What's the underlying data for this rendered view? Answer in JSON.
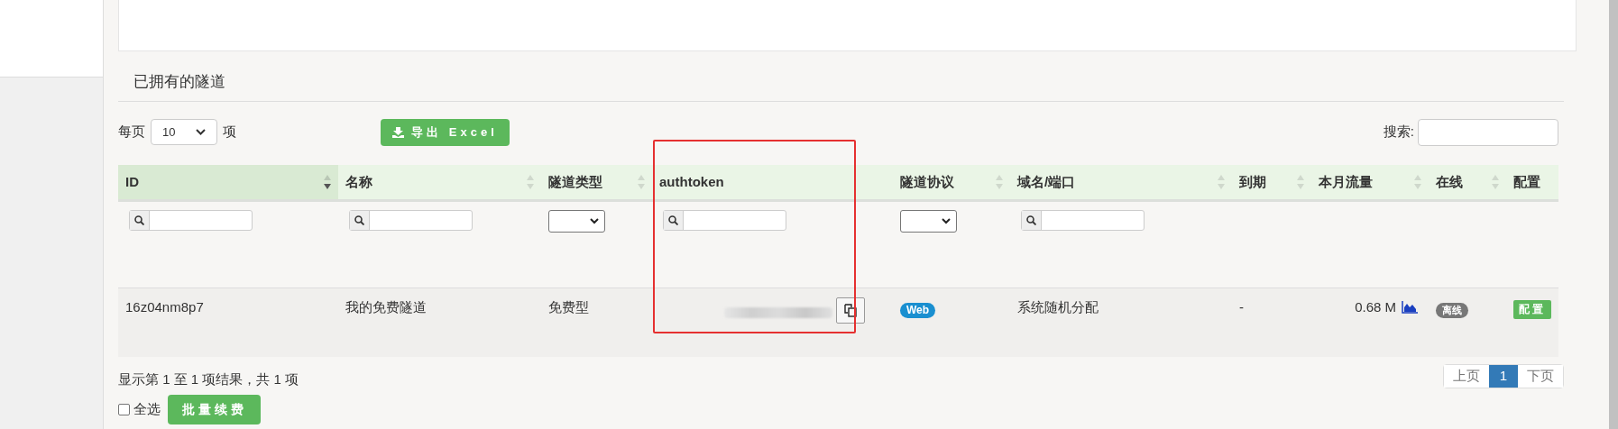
{
  "section_title": "已拥有的隧道",
  "page_size": {
    "label_before": "每页",
    "value": "10",
    "label_after": "项"
  },
  "export_button": "导出 Excel",
  "search": {
    "label": "搜索:"
  },
  "table": {
    "columns": [
      {
        "label": "ID",
        "sortable": true,
        "sorted": true,
        "filter": {
          "kind": "text"
        }
      },
      {
        "label": "名称",
        "sortable": true,
        "sorted": false,
        "filter": {
          "kind": "text"
        }
      },
      {
        "label": "隧道类型",
        "sortable": true,
        "sorted": false,
        "filter": {
          "kind": "select"
        }
      },
      {
        "label": "authtoken",
        "sortable": false,
        "filter": {
          "kind": "text"
        }
      },
      {
        "label": "隧道协议",
        "sortable": true,
        "sorted": false,
        "filter": {
          "kind": "select"
        }
      },
      {
        "label": "域名/端口",
        "sortable": true,
        "sorted": false,
        "filter": {
          "kind": "text"
        }
      },
      {
        "label": "到期",
        "sortable": true,
        "sorted": false
      },
      {
        "label": "本月流量",
        "sortable": true,
        "sorted": false
      },
      {
        "label": "在线",
        "sortable": true,
        "sorted": false
      },
      {
        "label": "配置",
        "sortable": false
      }
    ],
    "rows": [
      {
        "id": "16z04nm8p7",
        "name": "我的免费隧道",
        "type": "免费型",
        "protocol": "Web",
        "domain": "系统随机分配",
        "expiry": "-",
        "traffic": "0.68 M",
        "online_label": "离线",
        "online": false,
        "config_button": "配置"
      }
    ]
  },
  "summary": "显示第 1 至 1 项结果，共 1 项",
  "select_all": {
    "label": "全选",
    "checked": false
  },
  "batch_button": "批量续费",
  "pagination": [
    {
      "label": "上页",
      "selected": false
    },
    {
      "label": "1",
      "selected": true
    },
    {
      "label": "下页",
      "selected": false
    }
  ]
}
